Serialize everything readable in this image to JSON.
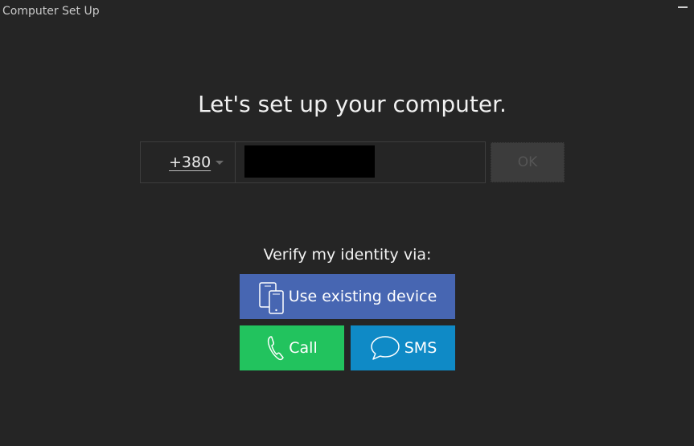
{
  "window": {
    "title": "Computer Set Up"
  },
  "main": {
    "heading": "Let's set up your computer.",
    "phone": {
      "country_code": "+380",
      "number_value": "",
      "ok_label": "OK"
    },
    "verify": {
      "label": "Verify my identity via:",
      "existing_device_label": "Use existing device",
      "call_label": "Call",
      "sms_label": "SMS"
    }
  },
  "icons": {
    "minimize": "minimize-icon",
    "dropdown": "chevron-down-icon",
    "device": "devices-icon",
    "call": "phone-icon",
    "sms": "chat-bubble-icon"
  },
  "colors": {
    "background": "#252525",
    "existing_device": "#4766b2",
    "call": "#22c35e",
    "sms": "#0f8ac6",
    "ok_disabled": "#3c3c3c"
  }
}
